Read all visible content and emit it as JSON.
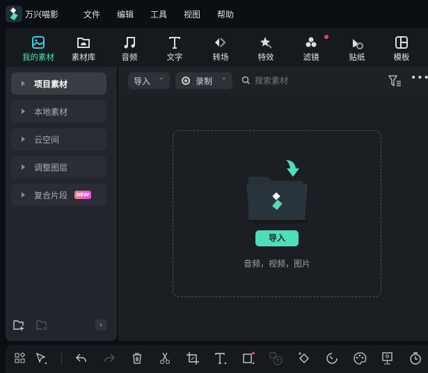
{
  "app": {
    "name": "万兴喵影",
    "menu": [
      "文件",
      "编辑",
      "工具",
      "视图",
      "帮助"
    ]
  },
  "toolbar": {
    "items": [
      {
        "label": "我的素材",
        "icon": "my-media-icon",
        "active": true
      },
      {
        "label": "素材库",
        "icon": "media-library-icon"
      },
      {
        "label": "音频",
        "icon": "music-note-icon"
      },
      {
        "label": "文字",
        "icon": "text-icon"
      },
      {
        "label": "转场",
        "icon": "transition-icon"
      },
      {
        "label": "特效",
        "icon": "effects-icon"
      },
      {
        "label": "滤镜",
        "icon": "filter-icon",
        "badge": true
      },
      {
        "label": "贴纸",
        "icon": "sticker-icon"
      },
      {
        "label": "模板",
        "icon": "template-icon"
      }
    ]
  },
  "sidebar": {
    "items": [
      {
        "label": "项目素材",
        "active": true
      },
      {
        "label": "本地素材"
      },
      {
        "label": "云空间"
      },
      {
        "label": "调整图层"
      },
      {
        "label": "复合片段",
        "badge": "NEW"
      }
    ]
  },
  "media": {
    "import_dropdown": "导入",
    "record_dropdown": "录制",
    "search_placeholder": "搜索素材",
    "import_button": "导入",
    "hint": "音频，视频，图片"
  },
  "colors": {
    "accent": "#4ddfb9",
    "badge_red": "#e9474f"
  },
  "bottom_tools": [
    "layout-icon",
    "select-tool-icon",
    "undo-icon",
    "redo-icon",
    "delete-icon",
    "cut-icon",
    "crop-icon",
    "text-icon",
    "shape-icon",
    "speech-to-text-icon",
    "keyframe-icon",
    "speed-icon",
    "color-palette-icon",
    "ai-portrait-icon",
    "timer-icon"
  ]
}
